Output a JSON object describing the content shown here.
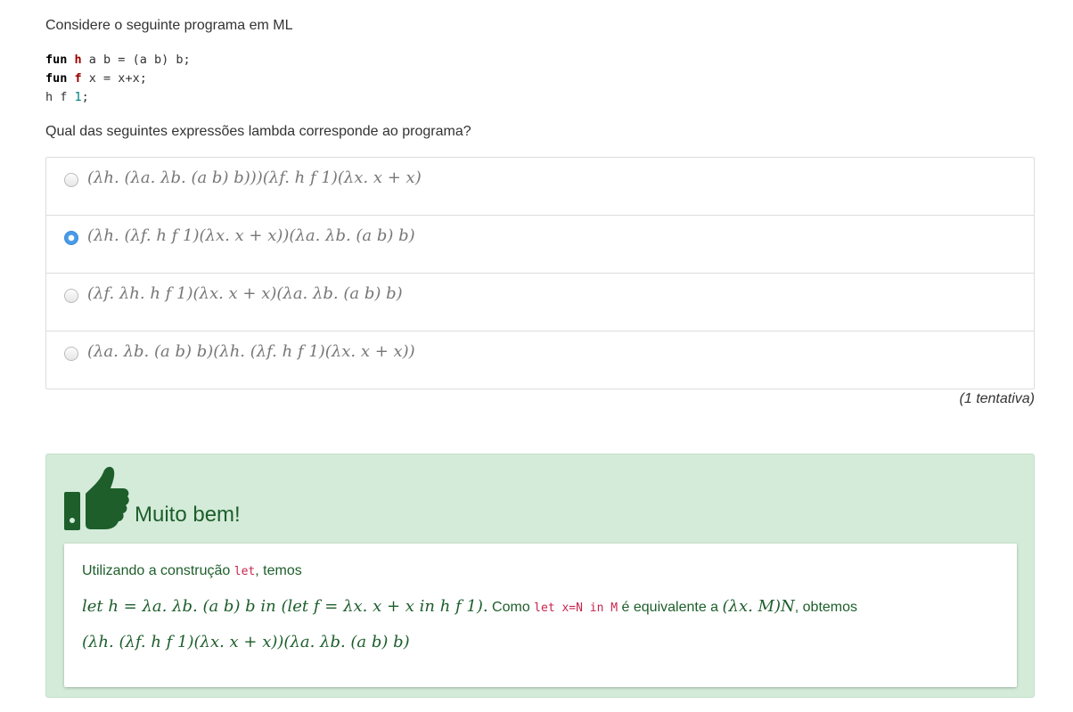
{
  "intro": "Considere o seguinte programa em ML",
  "code": {
    "line1": {
      "kw": "fun",
      "name": "h",
      "rest": " a b = (a b) b;"
    },
    "line2": {
      "kw": "fun",
      "name": "f",
      "rest": " x = x+x;"
    },
    "line3": {
      "start": "h f ",
      "num": "1",
      "end": ";"
    }
  },
  "question": "Qual das seguintes expressões lambda corresponde ao programa?",
  "options": [
    {
      "expr": "(λh. (λa. λb. (a b) b)))(λf. h f 1)(λx. x + x)",
      "selected": false
    },
    {
      "expr": "(λh. (λf. h f 1)(λx. x + x))(λa. λb. (a b) b)",
      "selected": true
    },
    {
      "expr": "(λf. λh. h f 1)(λx. x + x)(λa. λb. (a b) b)",
      "selected": false
    },
    {
      "expr": "(λa. λb. (a b) b)(λh. (λf. h f 1)(λx. x + x))",
      "selected": false
    }
  ],
  "attempts": "(1 tentativa)",
  "feedback": {
    "title": "Muito bem!",
    "icon": "thumbs-up-icon",
    "line1_pre": "Utilizando a construção ",
    "line1_code": "let",
    "line1_post": ", temos",
    "line2_math": "let h = λa. λb. (a b) b in (let f = λx. x + x in h f 1).",
    "line2_text1": " Como ",
    "line2_code": "let x=N in M",
    "line2_text2": " é equivalente a ",
    "line2_math2": "(λx. M)N",
    "line2_text3": ", obtemos",
    "line3_math": "(λh. (λf. h f 1)(λx. x + x))(λa. λb. (a b) b)"
  }
}
